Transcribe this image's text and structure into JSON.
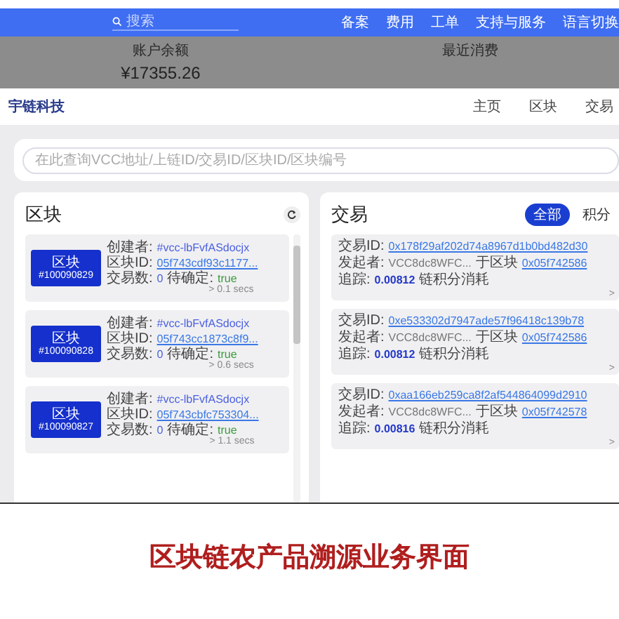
{
  "topbar": {
    "search": {
      "placeholder": "搜索"
    },
    "links": [
      "备案",
      "费用",
      "工单",
      "支持与服务",
      "语言切换"
    ]
  },
  "account": {
    "balance_label": "账户余额",
    "balance": "¥17355.26",
    "recent_label": "最近消费"
  },
  "header": {
    "logo": "宇链科技",
    "nav": [
      "主页",
      "区块",
      "交易"
    ]
  },
  "search": {
    "placeholder": "在此查询VCC地址/上链ID/交易ID/区块ID/区块编号"
  },
  "blocks": {
    "title": "区块",
    "items": [
      {
        "label": "区块",
        "number": "#100090829",
        "age": "> 0.1 secs",
        "lines": [
          [
            {
              "kind": "label",
              "text": "创建者:"
            },
            {
              "kind": "accent",
              "text": "#vcc-lbFvfASdocjx"
            }
          ],
          [
            {
              "kind": "label",
              "text": "区块ID:"
            },
            {
              "kind": "link",
              "text": "05f743cdf93c1177..."
            }
          ],
          [
            {
              "kind": "label",
              "text": "交易数:"
            },
            {
              "kind": "accent",
              "text": "0"
            },
            {
              "kind": "label",
              "text": "待确定:"
            },
            {
              "kind": "ok",
              "text": "true"
            }
          ]
        ]
      },
      {
        "label": "区块",
        "number": "#100090828",
        "age": "> 0.6 secs",
        "lines": [
          [
            {
              "kind": "label",
              "text": "创建者:"
            },
            {
              "kind": "accent",
              "text": "#vcc-lbFvfASdocjx"
            }
          ],
          [
            {
              "kind": "label",
              "text": "区块ID:"
            },
            {
              "kind": "link",
              "text": "05f743cc1873c8f9..."
            }
          ],
          [
            {
              "kind": "label",
              "text": "交易数:"
            },
            {
              "kind": "accent",
              "text": "0"
            },
            {
              "kind": "label",
              "text": "待确定:"
            },
            {
              "kind": "ok",
              "text": "true"
            }
          ]
        ]
      },
      {
        "label": "区块",
        "number": "#100090827",
        "age": "> 1.1 secs",
        "lines": [
          [
            {
              "kind": "label",
              "text": "创建者:"
            },
            {
              "kind": "accent",
              "text": "#vcc-lbFvfASdocjx"
            }
          ],
          [
            {
              "kind": "label",
              "text": "区块ID:"
            },
            {
              "kind": "link",
              "text": "05f743cbfc753304..."
            }
          ],
          [
            {
              "kind": "label",
              "text": "交易数:"
            },
            {
              "kind": "accent",
              "text": "0"
            },
            {
              "kind": "label",
              "text": "待确定:"
            },
            {
              "kind": "ok",
              "text": "true"
            }
          ]
        ]
      }
    ]
  },
  "transactions": {
    "title": "交易",
    "filters": [
      {
        "label": "全部",
        "selected": true
      },
      {
        "label": "积分",
        "selected": false
      }
    ],
    "items": [
      {
        "age": ">",
        "lines": [
          [
            {
              "kind": "label",
              "text": "交易ID:"
            },
            {
              "kind": "link",
              "text": "0x178f29af202d74a8967d1b0bd482d30"
            }
          ],
          [
            {
              "kind": "label",
              "text": "发起者:"
            },
            {
              "kind": "plain",
              "text": "VCC8dc8WFC..."
            },
            {
              "kind": "label",
              "text": "于区块"
            },
            {
              "kind": "link",
              "text": "0x05f742586"
            }
          ],
          [
            {
              "kind": "label",
              "text": "追踪:"
            },
            {
              "kind": "strong",
              "text": "0.00812"
            },
            {
              "kind": "label",
              "text": "链积分消耗"
            }
          ]
        ]
      },
      {
        "age": ">",
        "lines": [
          [
            {
              "kind": "label",
              "text": "交易ID:"
            },
            {
              "kind": "link",
              "text": "0xe533302d7947ade57f96418c139b78"
            }
          ],
          [
            {
              "kind": "label",
              "text": "发起者:"
            },
            {
              "kind": "plain",
              "text": "VCC8dc8WFC..."
            },
            {
              "kind": "label",
              "text": "于区块"
            },
            {
              "kind": "link",
              "text": "0x05f742586"
            }
          ],
          [
            {
              "kind": "label",
              "text": "追踪:"
            },
            {
              "kind": "strong",
              "text": "0.00812"
            },
            {
              "kind": "label",
              "text": "链积分消耗"
            }
          ]
        ]
      },
      {
        "age": ">",
        "lines": [
          [
            {
              "kind": "label",
              "text": "交易ID:"
            },
            {
              "kind": "link",
              "text": "0xaa166eb259ca8f2af544864099d2910"
            }
          ],
          [
            {
              "kind": "label",
              "text": "发起者:"
            },
            {
              "kind": "plain",
              "text": "VCC8dc8WFC..."
            },
            {
              "kind": "label",
              "text": "于区块"
            },
            {
              "kind": "link",
              "text": "0x05f742578"
            }
          ],
          [
            {
              "kind": "label",
              "text": "追踪:"
            },
            {
              "kind": "strong",
              "text": "0.00816"
            },
            {
              "kind": "label",
              "text": "链积分消耗"
            }
          ]
        ]
      }
    ]
  },
  "caption": "区块链农产品溯源业务界面"
}
